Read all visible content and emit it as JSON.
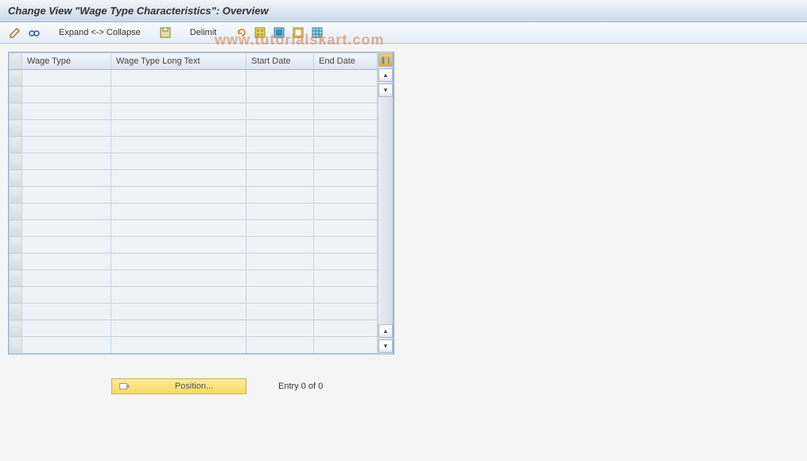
{
  "title": "Change View \"Wage Type Characteristics\": Overview",
  "toolbar": {
    "expand_collapse": "Expand <-> Collapse",
    "delimit": "Delimit"
  },
  "table": {
    "headers": {
      "wage_type": "Wage Type",
      "long_text": "Wage Type Long Text",
      "start_date": "Start Date",
      "end_date": "End Date"
    },
    "rows": [
      {},
      {},
      {},
      {},
      {},
      {},
      {},
      {},
      {},
      {},
      {},
      {},
      {},
      {},
      {},
      {},
      {}
    ]
  },
  "footer": {
    "position_label": "Position...",
    "entry_status": "Entry 0 of 0"
  },
  "watermark": "www.tutorialskart.com"
}
